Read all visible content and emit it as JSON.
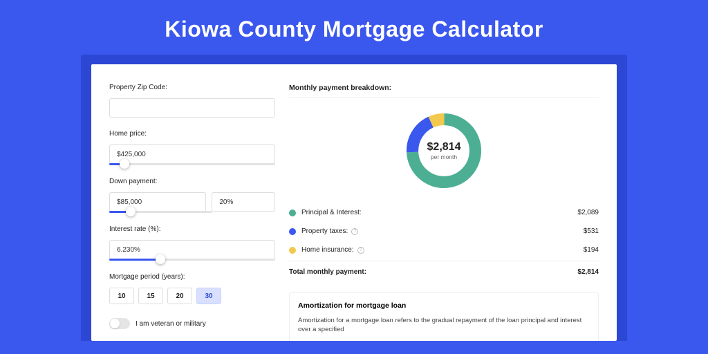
{
  "page_title": "Kiowa County Mortgage Calculator",
  "form": {
    "zip_label": "Property Zip Code:",
    "zip_value": "",
    "home_price_label": "Home price:",
    "home_price_value": "$425,000",
    "home_price_slider_pct": 9,
    "down_label": "Down payment:",
    "down_value": "$85,000",
    "down_pct_value": "20%",
    "down_slider_pct": 21,
    "rate_label": "Interest rate (%):",
    "rate_value": "6.230%",
    "rate_slider_pct": 31,
    "period_label": "Mortgage period (years):",
    "periods": [
      "10",
      "15",
      "20",
      "30"
    ],
    "period_selected": "30",
    "veteran_label": "I am veteran or military"
  },
  "breakdown": {
    "title": "Monthly payment breakdown:",
    "center_value": "$2,814",
    "center_sub": "per month",
    "items": [
      {
        "label": "Principal & Interest:",
        "value": "$2,089",
        "color": "g",
        "info": false
      },
      {
        "label": "Property taxes:",
        "value": "$531",
        "color": "b",
        "info": true
      },
      {
        "label": "Home insurance:",
        "value": "$194",
        "color": "y",
        "info": true
      }
    ],
    "total_label": "Total monthly payment:",
    "total_value": "$2,814"
  },
  "chart_data": {
    "type": "pie",
    "title": "Monthly payment breakdown",
    "series": [
      {
        "name": "Principal & Interest",
        "value": 2089,
        "color": "#4caf93"
      },
      {
        "name": "Property taxes",
        "value": 531,
        "color": "#3a57ee"
      },
      {
        "name": "Home insurance",
        "value": 194,
        "color": "#f2c94c"
      }
    ],
    "total": 2814,
    "center_label": "$2,814 per month"
  },
  "amortization": {
    "title": "Amortization for mortgage loan",
    "text": "Amortization for a mortgage loan refers to the gradual repayment of the loan principal and interest over a specified"
  }
}
